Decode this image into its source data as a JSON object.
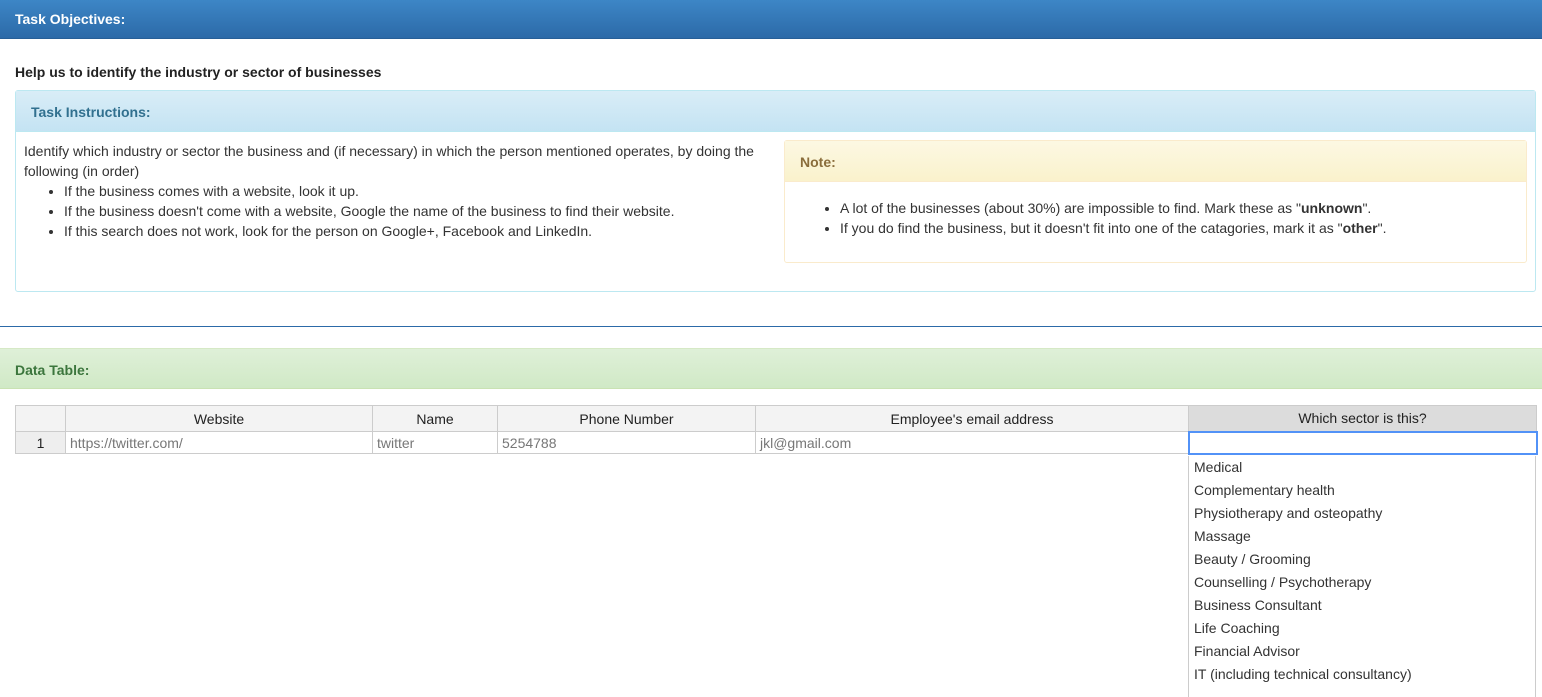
{
  "objectives": {
    "heading": "Task Objectives:",
    "text": "Help us to identify the industry or sector of businesses"
  },
  "instructions": {
    "heading": "Task Instructions:",
    "intro": "Identify which industry or sector the business and (if necessary) in which the person mentioned operates, by doing the following (in order)",
    "steps": [
      "If the business comes with a website, look it up.",
      "If the business doesn't come with a website, Google the name of the business to find their website.",
      "If this search does not work, look for the person on Google+, Facebook and LinkedIn."
    ]
  },
  "note": {
    "heading": "Note:",
    "item1_before": "A lot of the businesses (about 30%) are impossible to find. Mark these as \"",
    "item1_bold": "unknown",
    "item1_after": "\".",
    "item2_before": "If you do find the business, but it doesn't fit into one of the catagories, mark it as \"",
    "item2_bold": "other",
    "item2_after": "\"."
  },
  "data_table": {
    "heading": "Data Table:",
    "columns": [
      "",
      "Website",
      "Name",
      "Phone Number",
      "Employee's email address",
      "Which sector is this?"
    ],
    "rows": [
      {
        "num": "1",
        "website": "https://twitter.com/",
        "name": "twitter",
        "phone": "5254788",
        "email": "jkl@gmail.com",
        "sector": ""
      }
    ]
  },
  "sector_options": [
    "Medical",
    "Complementary health",
    "Physiotherapy and osteopathy",
    "Massage",
    "Beauty / Grooming",
    "Counselling / Psychotherapy",
    "Business Consultant",
    "Life Coaching",
    "Financial Advisor",
    "IT (including technical consultancy)"
  ]
}
